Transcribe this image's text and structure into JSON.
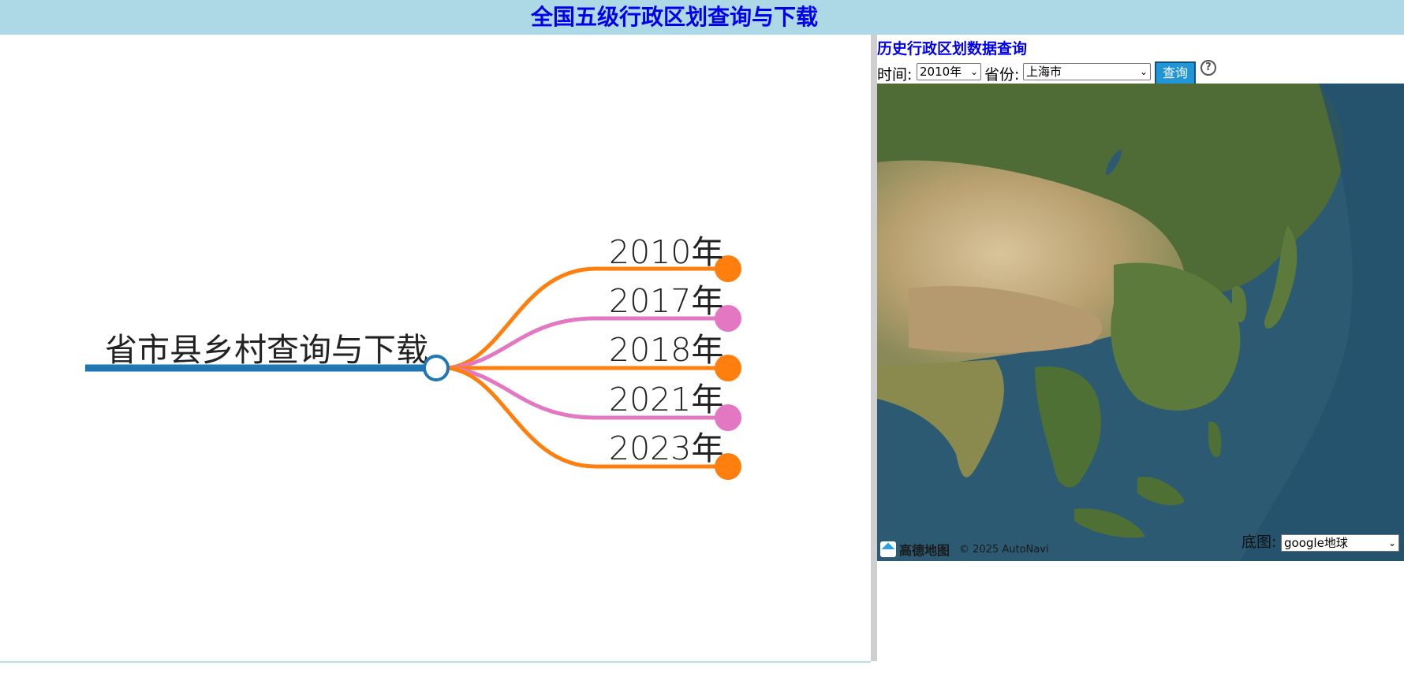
{
  "header": {
    "title": "全国五级行政区划查询与下载"
  },
  "mindmap": {
    "root_label": "省市县乡村查询与下载",
    "branches": [
      {
        "label": "2010年",
        "color": "#ff7f0e"
      },
      {
        "label": "2017年",
        "color": "#e377c2"
      },
      {
        "label": "2018年",
        "color": "#ff7f0e"
      },
      {
        "label": "2021年",
        "color": "#e377c2"
      },
      {
        "label": "2023年",
        "color": "#ff7f0e"
      }
    ],
    "root_color": "#1f77b4"
  },
  "query_panel": {
    "title": "历史行政区划数据查询",
    "time_label": "时间:",
    "time_value": "2010年",
    "province_label": "省份:",
    "province_value": "上海市",
    "query_button": "查询",
    "help": "?"
  },
  "map": {
    "logo_text": "高德地图",
    "copyright": "© 2025 AutoNavi",
    "basemap_label": "底图:",
    "basemap_value": "google地球"
  },
  "colors": {
    "header_bg": "#add8e6",
    "title_color": "#0000ee",
    "button_bg": "#2196d6"
  }
}
